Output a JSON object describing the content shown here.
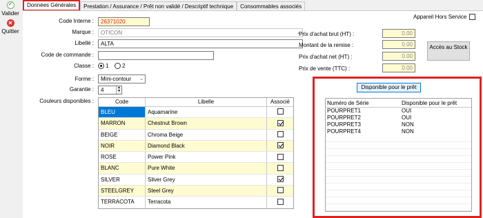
{
  "toolbar": {
    "valider_label": "Valider",
    "quitter_label": "Quitter",
    "valider_icon": "check-circle-icon",
    "quitter_icon": "close-circle-icon"
  },
  "tabs": [
    {
      "label": "Données Générales",
      "active": true
    },
    {
      "label": "Prestation / Assurance / Prêt non validé / Descriptif technique",
      "active": false
    },
    {
      "label": "Consommables associés",
      "active": false
    }
  ],
  "form": {
    "code_interne": {
      "label": "Code Interne :",
      "value": "26371020"
    },
    "marque": {
      "label": "Marque :",
      "value": "OTICON"
    },
    "libelle": {
      "label": "Libellé :",
      "value": "ALTA"
    },
    "code_commande": {
      "label": "Code de commande :",
      "value": ""
    },
    "classe": {
      "label": "Classe :",
      "option1": "1",
      "option2": "2",
      "selected": "1"
    },
    "forme": {
      "label": "Forme :",
      "value": "Mini-contour"
    },
    "garantie": {
      "label": "Garantie :",
      "value": "4"
    },
    "couleurs_label": "Couleurs disponibles :",
    "appareil_hors_service": {
      "label": "Appareil Hors Service",
      "checked": false
    }
  },
  "prices": {
    "prix_achat_brut": {
      "label": "Prix d'achat brut (HT) :",
      "value": "0.00"
    },
    "montant_remise": {
      "label": "Montant de la remise :",
      "value": "0.00"
    },
    "prix_achat_net": {
      "label": "Prix d'achat net (HT) :",
      "value": "0.00"
    },
    "prix_vente": {
      "label": "Prix de vente (TTC) :",
      "value": "0.00"
    }
  },
  "acces_stock_label": "Accès au Stock",
  "colors_table": {
    "headers": [
      "Code",
      "Libelle",
      "Associé"
    ],
    "rows": [
      {
        "code": "BLEU",
        "libelle": "Aquamarine",
        "associe": false
      },
      {
        "code": "MARRON",
        "libelle": "Chestnut Brown",
        "associe": true
      },
      {
        "code": "BEIGE",
        "libelle": "Chroma Beige",
        "associe": false
      },
      {
        "code": "NOIR",
        "libelle": "Diamond Black",
        "associe": true
      },
      {
        "code": "ROSE",
        "libelle": "Power Pink",
        "associe": false
      },
      {
        "code": "BLANC",
        "libelle": "Pure White",
        "associe": false
      },
      {
        "code": "SILVER",
        "libelle": "Silver Grey",
        "associe": true
      },
      {
        "code": "STEELGREY",
        "libelle": "Steel Grey",
        "associe": false
      },
      {
        "code": "TERRACOTA",
        "libelle": "Terracota",
        "associe": false
      }
    ]
  },
  "disponible_button_label": "Disponible pour le prêt",
  "serie_table": {
    "headers": [
      "Numéro de Série",
      "Disponible pour le prêt"
    ],
    "rows": [
      {
        "numero": "POURPRET1",
        "dispo": "OUI"
      },
      {
        "numero": "POURPRET2",
        "dispo": "OUI"
      },
      {
        "numero": "POURPRET3",
        "dispo": "NON"
      },
      {
        "numero": "POURPRET4",
        "dispo": "NON"
      }
    ]
  },
  "colors": {
    "highlight": "#e02020",
    "row_alt": "#fffbd0",
    "selection": "#0078d7"
  }
}
